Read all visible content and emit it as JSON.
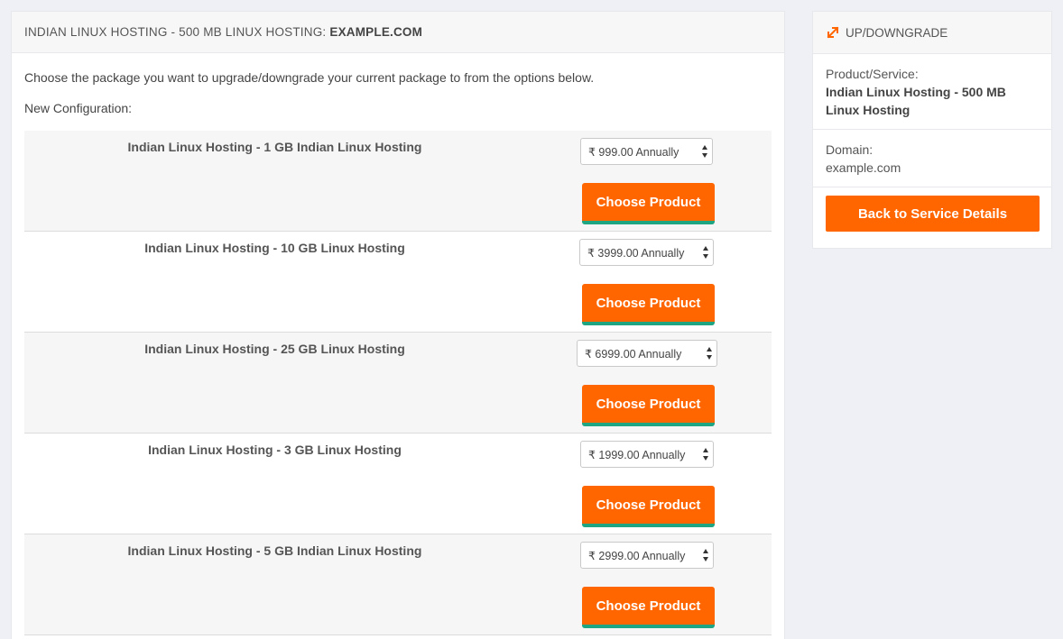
{
  "main": {
    "title_prefix": "INDIAN LINUX HOSTING - 500 MB LINUX HOSTING:",
    "title_domain": "EXAMPLE.COM",
    "intro": "Choose the package you want to upgrade/downgrade your current package to from the options below.",
    "new_config_label": "New Configuration:",
    "choose_label": "Choose Product",
    "packages": [
      {
        "name": "Indian Linux Hosting - 1 GB Indian Linux Hosting",
        "price": "₹ 999.00 Annually"
      },
      {
        "name": "Indian Linux Hosting - 10 GB Linux Hosting",
        "price": "₹ 3999.00 Annually"
      },
      {
        "name": "Indian Linux Hosting - 25 GB Linux Hosting",
        "price": "₹ 6999.00 Annually"
      },
      {
        "name": "Indian Linux Hosting - 3 GB Linux Hosting",
        "price": "₹ 1999.00 Annually"
      },
      {
        "name": "Indian Linux Hosting - 5 GB Indian Linux Hosting",
        "price": "₹ 2999.00 Annually"
      }
    ]
  },
  "sidebar": {
    "title": "UP/DOWNGRADE",
    "icon": "expand-arrows-icon",
    "product_label": "Product/Service:",
    "product_value": "Indian Linux Hosting - 500 MB Linux Hosting",
    "domain_label": "Domain:",
    "domain_value": "example.com",
    "back_button": "Back to Service Details"
  },
  "colors": {
    "accent": "#ff6600",
    "button_underline": "#20a582",
    "background": "#eef0f5"
  }
}
